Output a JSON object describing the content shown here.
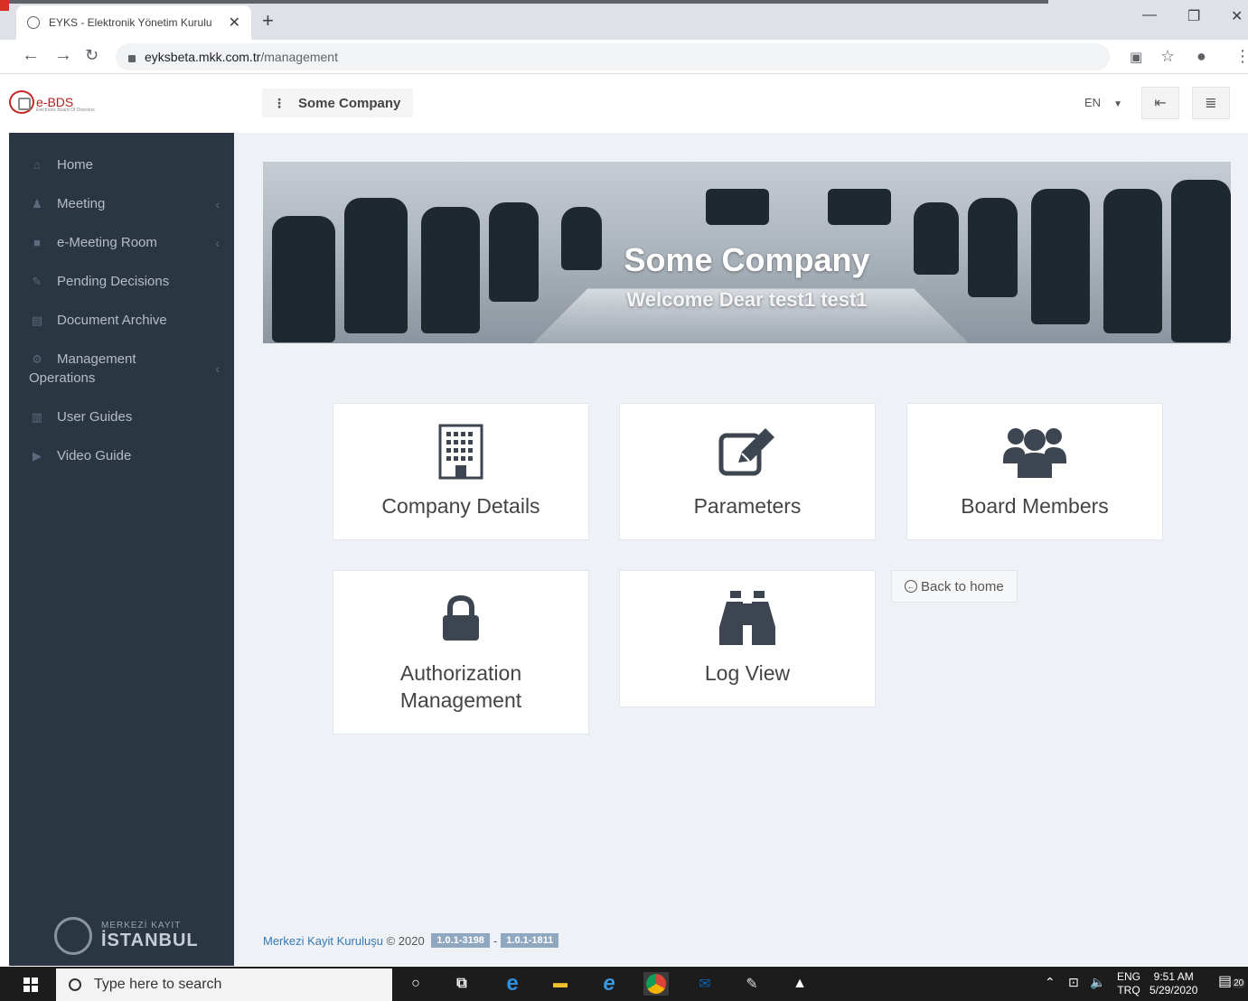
{
  "browser": {
    "tab_title": "EYKS - Elektronik Yönetim Kurulu",
    "url_host": "eyksbeta.mkk.com.tr",
    "url_path": "/management"
  },
  "header": {
    "logo_text": "e-BDS",
    "logo_sub": "Electronic Board Of Directors",
    "company": "Some Company",
    "language": "EN"
  },
  "sidebar": {
    "items": [
      {
        "label": "Home",
        "icon": "home-icon"
      },
      {
        "label": "Meeting",
        "icon": "users-icon"
      },
      {
        "label": "e-Meeting Room",
        "icon": "video-icon"
      },
      {
        "label": "Pending Decisions",
        "icon": "pencil-icon"
      },
      {
        "label": "Document Archive",
        "icon": "archive-icon"
      },
      {
        "label": "Management",
        "label2": "Operations",
        "icon": "cogs-icon"
      },
      {
        "label": "User Guides",
        "icon": "book-icon"
      },
      {
        "label": "Video Guide",
        "icon": "play-icon"
      }
    ],
    "footer_logo_line1": "MERKEZİ KAYIT",
    "footer_logo_line2": "İSTANBUL"
  },
  "banner": {
    "title": "Some Company",
    "welcome": "Welcome Dear test1 test1"
  },
  "cards": {
    "company_details": "Company Details",
    "parameters": "Parameters",
    "board_members": "Board Members",
    "auth_line1": "Authorization",
    "auth_line2": "Management",
    "log_view": "Log View"
  },
  "back_button": "Back to home",
  "footer": {
    "org": "Merkezi Kayit Kuruluşu",
    "copyright": "© 2020",
    "version1": "1.0.1-3198",
    "separator": "-",
    "version2": "1.0.1-1811"
  },
  "taskbar": {
    "search_placeholder": "Type here to search",
    "lang1": "ENG",
    "lang2": "TRQ",
    "time": "9:51 AM",
    "date": "5/29/2020",
    "notifications": "20"
  },
  "colors": {
    "sidebar_bg": "#2b3643",
    "main_bg": "#eef1f5",
    "icon_dark": "#3d4650",
    "link_blue": "#337ab7"
  }
}
